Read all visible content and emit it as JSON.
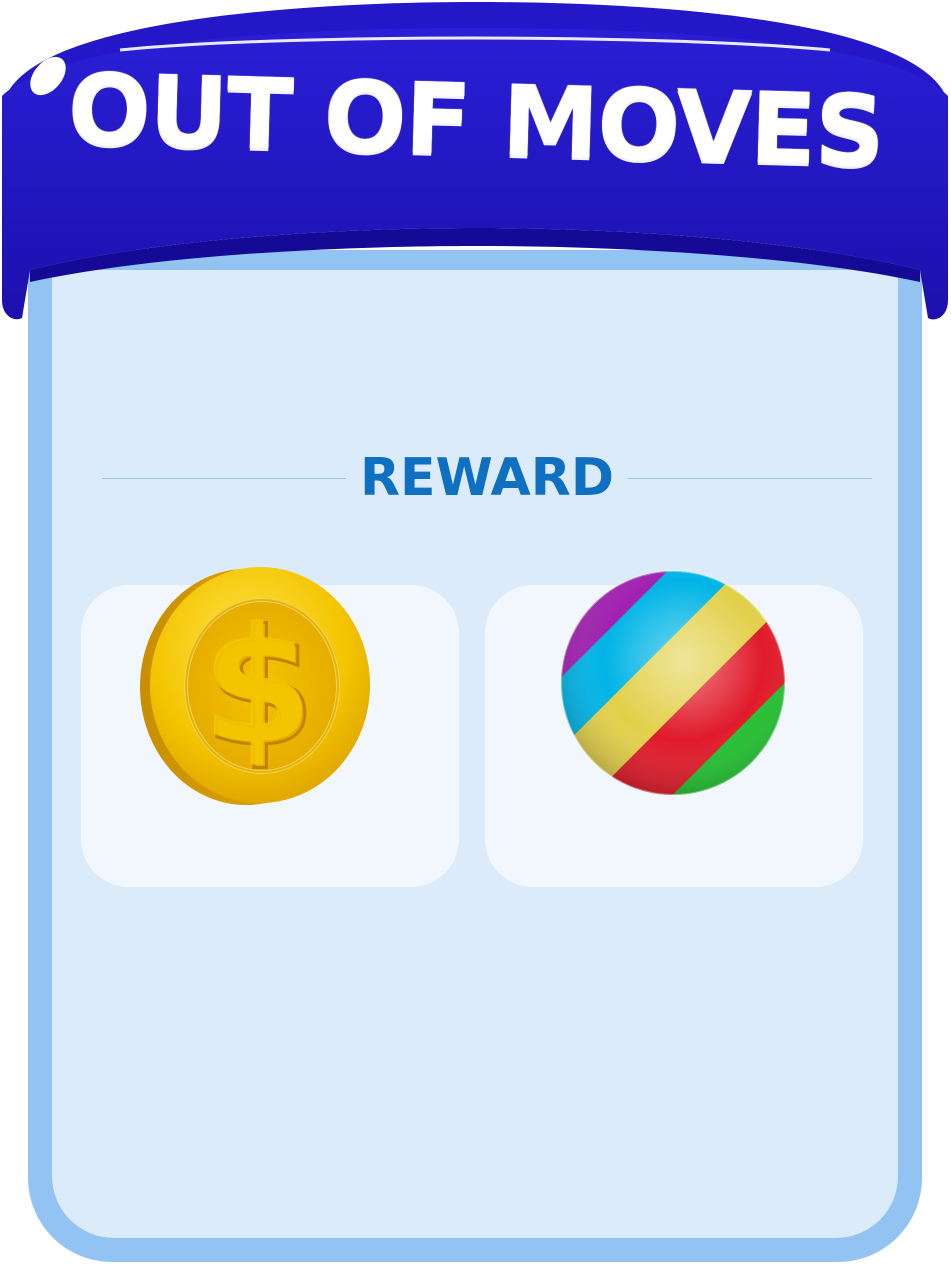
{
  "popup": {
    "title": "OUT OF MOVES"
  },
  "reward_section": {
    "heading": "REWARD"
  },
  "rewards": [
    {
      "item": "coin",
      "icon": "dollar-coin-icon"
    },
    {
      "item": "rainbow-ball",
      "icon": "striped-ball-icon"
    }
  ],
  "colors": {
    "banner": "#2417c7",
    "banner_dark": "#1a0ca8",
    "panel_border": "#93c3f2",
    "panel_fill": "#dcebf9",
    "slot_fill": "#f2f7fd",
    "heading_text": "#0f6fc0",
    "coin_gold": "#f2c200"
  }
}
